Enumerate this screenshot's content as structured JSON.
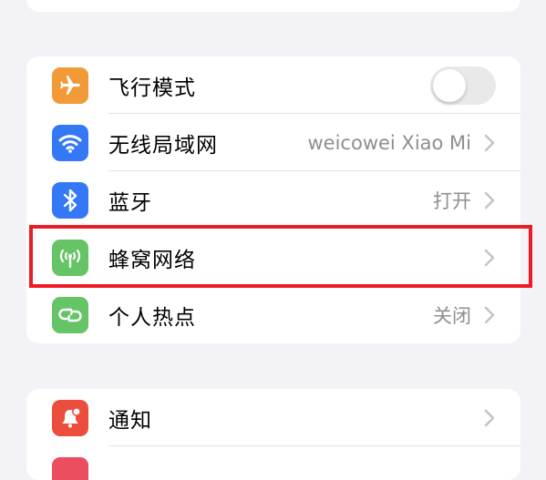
{
  "colors": {
    "page_bg": "#f2f2f7",
    "highlight": "#ec1c24",
    "airplane": "#f19a37",
    "wifi": "#3478f6",
    "bluetooth": "#3478f6",
    "cellular": "#65c466",
    "hotspot": "#65c466",
    "notifications": "#eb4e3d"
  },
  "connectivity": {
    "rows": [
      {
        "label": "飞行模式",
        "icon": "airplane-icon",
        "control": "toggle",
        "toggle_on": false
      },
      {
        "label": "无线局域网",
        "icon": "wifi-icon",
        "value": "weicowei Xiao Mi"
      },
      {
        "label": "蓝牙",
        "icon": "bluetooth-icon",
        "value": "打开"
      },
      {
        "label": "蜂窝网络",
        "icon": "cellular-antenna-icon",
        "value": ""
      },
      {
        "label": "个人热点",
        "icon": "hotspot-link-icon",
        "value": "关闭"
      }
    ]
  },
  "notifications_group": {
    "rows": [
      {
        "label": "通知",
        "icon": "notification-bell-icon",
        "value": ""
      }
    ]
  }
}
